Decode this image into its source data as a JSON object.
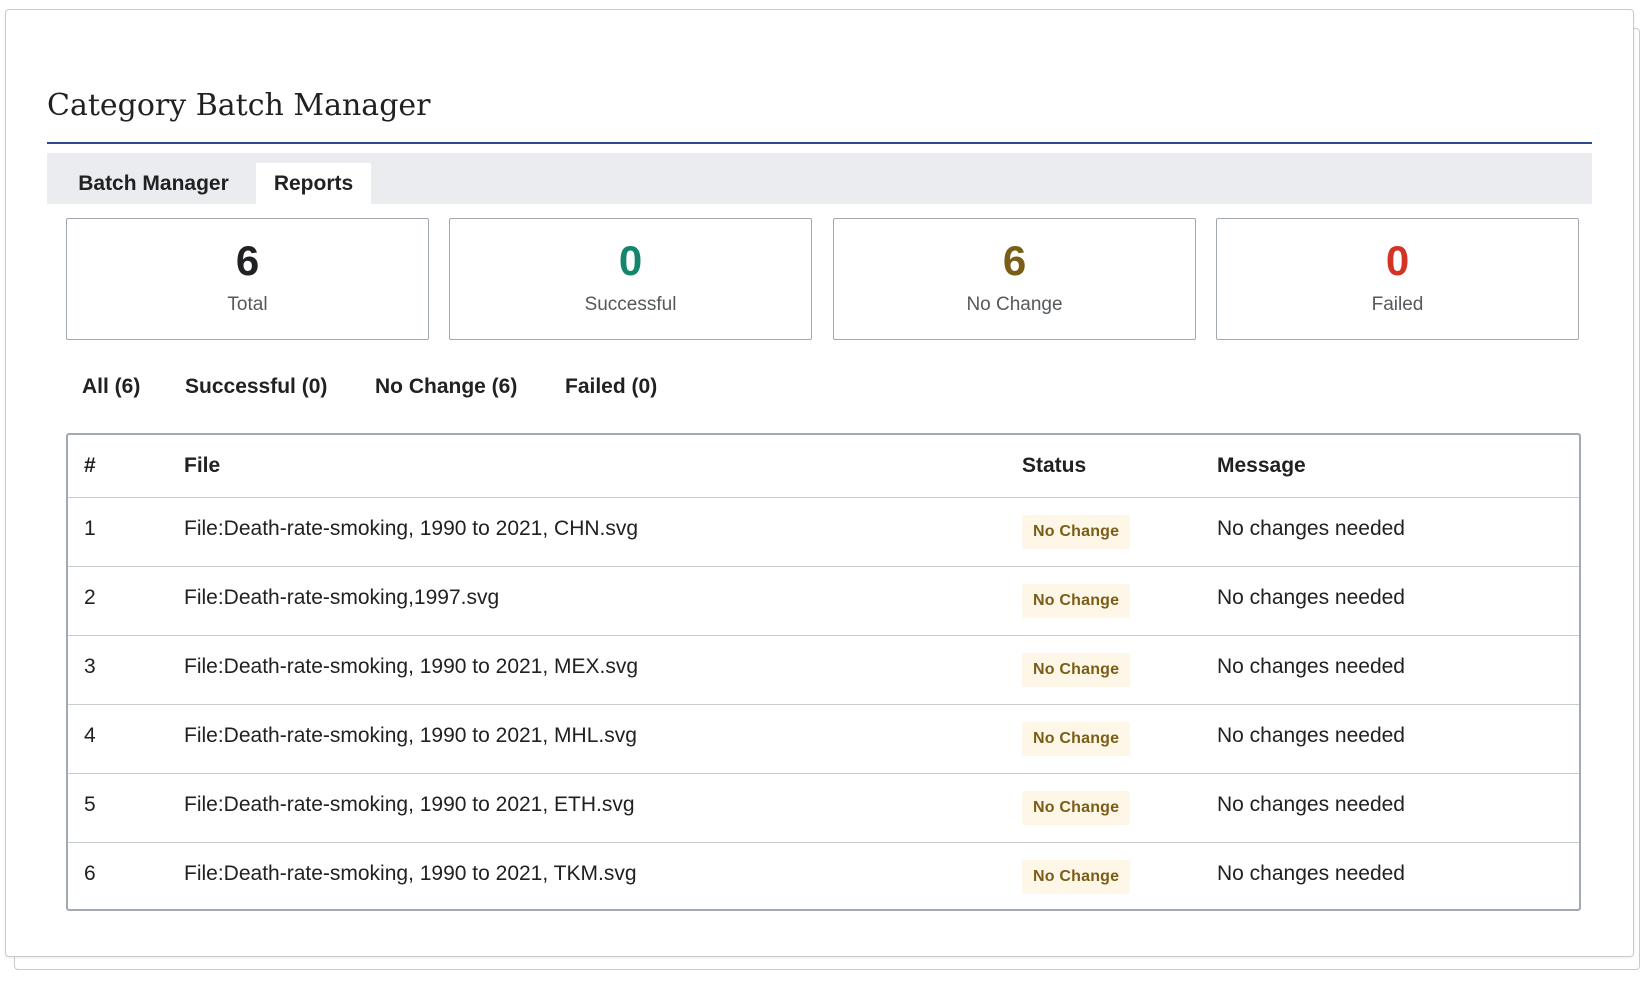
{
  "page": {
    "title": "Category Batch Manager"
  },
  "tabs": [
    {
      "label": "Batch Manager",
      "active": false
    },
    {
      "label": "Reports",
      "active": true
    }
  ],
  "stats": [
    {
      "value": "6",
      "label": "Total",
      "color": "#202122"
    },
    {
      "value": "0",
      "label": "Successful",
      "color": "#14866d"
    },
    {
      "value": "6",
      "label": "No Change",
      "color": "#7a5e18"
    },
    {
      "value": "0",
      "label": "Failed",
      "color": "#d33426"
    }
  ],
  "filters": [
    {
      "label": "All (6)"
    },
    {
      "label": "Successful (0)"
    },
    {
      "label": "No Change (6)"
    },
    {
      "label": "Failed (0)"
    }
  ],
  "table": {
    "headers": [
      "#",
      "File",
      "Status",
      "Message"
    ],
    "rows": [
      {
        "num": "1",
        "file": "File:Death-rate-smoking, 1990 to 2021, CHN.svg",
        "status": "No Change",
        "message": "No changes needed"
      },
      {
        "num": "2",
        "file": "File:Death-rate-smoking,1997.svg",
        "status": "No Change",
        "message": "No changes needed"
      },
      {
        "num": "3",
        "file": "File:Death-rate-smoking, 1990 to 2021, MEX.svg",
        "status": "No Change",
        "message": "No changes needed"
      },
      {
        "num": "4",
        "file": "File:Death-rate-smoking, 1990 to 2021, MHL.svg",
        "status": "No Change",
        "message": "No changes needed"
      },
      {
        "num": "5",
        "file": "File:Death-rate-smoking, 1990 to 2021, ETH.svg",
        "status": "No Change",
        "message": "No changes needed"
      },
      {
        "num": "6",
        "file": "File:Death-rate-smoking, 1990 to 2021, TKM.svg",
        "status": "No Change",
        "message": "No changes needed"
      }
    ]
  },
  "colors": {
    "accent_rule": "#2a4b8d",
    "badge_bg": "#fef6e7",
    "badge_text": "#7a5e18"
  }
}
